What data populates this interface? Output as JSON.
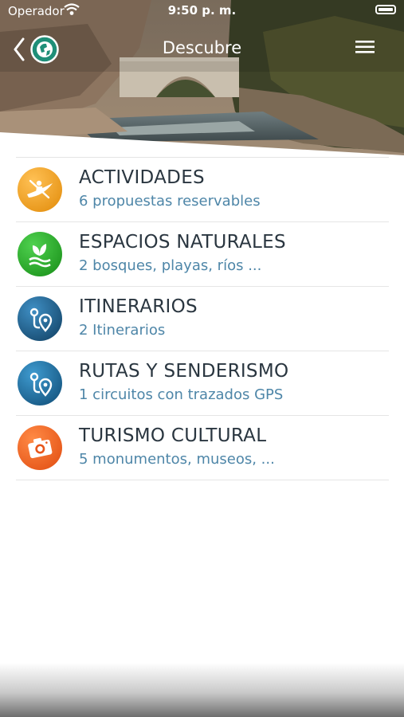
{
  "status_bar": {
    "carrier": "Operador",
    "time": "9:50 p. m."
  },
  "nav": {
    "title": "Descubre",
    "back_icon": "chevron-left-icon",
    "logo_icon": "globe-icon",
    "menu_icon": "hamburger-menu-icon"
  },
  "categories": [
    {
      "title": "ACTIVIDADES",
      "subtitle": "6 propuestas reservables",
      "icon": "kayak-icon",
      "color": "#f09a16"
    },
    {
      "title": "ESPACIOS NATURALES",
      "subtitle": "2 bosques, playas, ríos ...",
      "icon": "leaf-water-icon",
      "color": "#2fa12f"
    },
    {
      "title": "ITINERARIOS",
      "subtitle": "2 Itinerarios",
      "icon": "route-pin-icon",
      "color": "#1d5e8a"
    },
    {
      "title": "RUTAS Y SENDERISMO",
      "subtitle": "1 circuitos con trazados GPS",
      "icon": "route-pin-icon",
      "color": "#1d6a9a"
    },
    {
      "title": "TURISMO CULTURAL",
      "subtitle": "5 monumentos, museos, ...",
      "icon": "camera-icon",
      "color": "#f0611f"
    }
  ]
}
